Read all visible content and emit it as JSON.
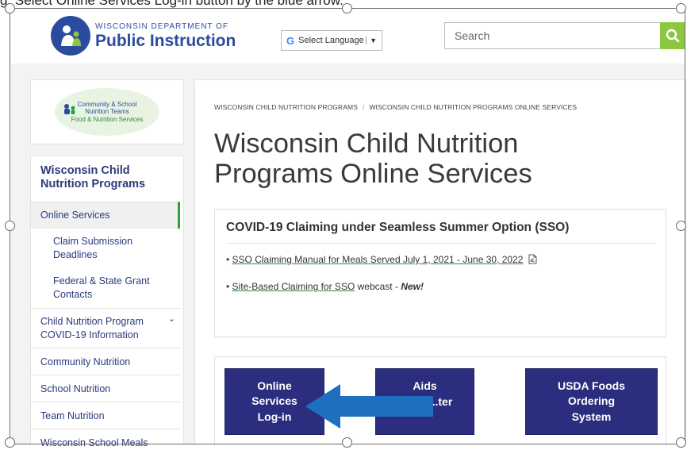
{
  "caption": "g. Select Online Services Log-in button by the blue arrow.",
  "header": {
    "logo_small": "WISCONSIN DEPARTMENT OF",
    "logo_big": "Public Instruction",
    "language_label": "Select Language",
    "search_placeholder": "Search"
  },
  "sidebar": {
    "logo_lines": [
      "Community & School",
      "Nutrition Teams",
      "Food & Nutrition Services"
    ],
    "title_line1": "Wisconsin Child",
    "title_line2": "Nutrition Programs",
    "items": [
      {
        "label": "Online Services"
      },
      {
        "label": "Claim Submission Deadlines"
      },
      {
        "label": "Federal & State Grant Contacts"
      },
      {
        "label": "Child Nutrition Program COVID-19 Information"
      },
      {
        "label": "Community Nutrition"
      },
      {
        "label": "School Nutrition"
      },
      {
        "label": "Team Nutrition"
      },
      {
        "label": "Wisconsin School Meals"
      }
    ]
  },
  "main": {
    "breadcrumb": [
      "WISCONSIN CHILD NUTRITION PROGRAMS",
      "WISCONSIN CHILD NUTRITION PROGRAMS ONLINE SERVICES"
    ],
    "title_line1": "Wisconsin Child Nutrition",
    "title_line2": "Programs Online Services",
    "covid_title": "COVID-19 Claiming under Seamless Summer Option (SSO)",
    "bullets": [
      {
        "link": "SSO Claiming Manual for Meals Served July 1, 2021 - June 30, 2022",
        "suffix": ""
      },
      {
        "link": "Site-Based Claiming for SSO",
        "suffix": " webcast - ",
        "emphasis": "New!"
      }
    ],
    "buttons": [
      {
        "lines": [
          "Online",
          "Services",
          "Log-in"
        ]
      },
      {
        "lines": [
          "Aids",
          "...ter"
        ]
      },
      {
        "lines": [
          "USDA Foods",
          "Ordering",
          "System"
        ]
      }
    ]
  },
  "colors": {
    "brand_blue": "#2b4c9e",
    "button_navy": "#2b2e7e",
    "accent_green": "#2e9e3e",
    "search_green": "#8dc63f",
    "arrow_blue": "#1f6fc0"
  }
}
